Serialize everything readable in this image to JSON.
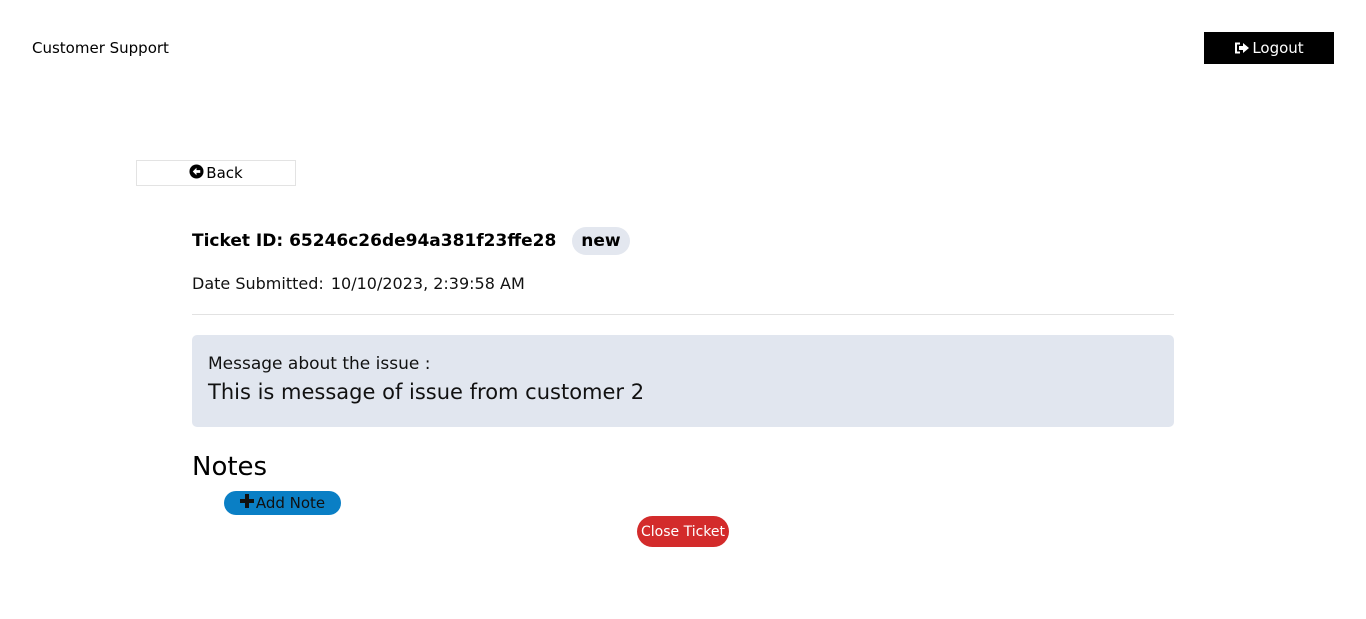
{
  "header": {
    "brand": "Customer Support",
    "logout_label": "Logout",
    "logout_icon": "sign-out-icon"
  },
  "back": {
    "label": "Back",
    "icon": "arrow-circle-left-icon"
  },
  "ticket": {
    "id_label": "Ticket ID: 65246c26de94a381f23ffe28",
    "status": "new",
    "date_label": "Date Submitted:",
    "date_value": "10/10/2023, 2:39:58 AM"
  },
  "message": {
    "label": "Message about the issue :",
    "text": "This is message of issue from customer 2"
  },
  "notes": {
    "title": "Notes",
    "add_label": "Add Note",
    "add_icon": "plus-icon"
  },
  "actions": {
    "close_label": "Close Ticket"
  },
  "colors": {
    "logout_bg": "#000000",
    "badge_bg": "#e3e7ef",
    "message_bg": "#e1e6ef",
    "add_note_bg": "#0a7fc5",
    "close_bg": "#d32b2b"
  }
}
